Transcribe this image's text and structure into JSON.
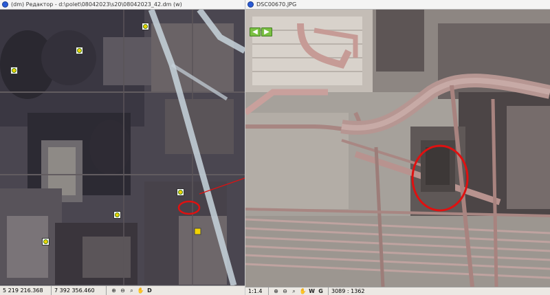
{
  "map_window": {
    "title": "(dm) Редактор - d:\\polet\\08042023\\s20\\08042023_42.dm (w)",
    "status": {
      "coord_x": "5 219 216.368",
      "coord_y": "7 392 356.460",
      "tools": [
        {
          "icon": "zoom-in-icon",
          "glyph": "⊕"
        },
        {
          "icon": "zoom-out-icon",
          "glyph": "⊖"
        },
        {
          "icon": "zoom-fit-icon",
          "glyph": "⌕"
        },
        {
          "icon": "pan-hand-icon",
          "glyph": "✋"
        },
        {
          "icon": "d-tool-icon",
          "glyph": "D"
        }
      ]
    }
  },
  "photo_window": {
    "title": "DSC00670.JPG",
    "nav": {
      "prev": "◀",
      "next": "▶"
    },
    "status": {
      "scale": "1:1.4",
      "pixel_coords": "3089 : 1362",
      "tools": [
        {
          "icon": "zoom-in-icon",
          "glyph": "⊕"
        },
        {
          "icon": "zoom-out-icon",
          "glyph": "⊖"
        },
        {
          "icon": "zoom-fit-icon",
          "glyph": "⌕"
        },
        {
          "icon": "pan-hand-icon",
          "glyph": "✋"
        },
        {
          "icon": "w-tool-icon",
          "glyph": "W"
        },
        {
          "icon": "g-tool-icon",
          "glyph": "G"
        }
      ]
    }
  },
  "colors": {
    "annotation_red": "#e01010",
    "map_track": "#c7d3dc",
    "marker_fill": "#f2d300",
    "nav_green": "#7bc043"
  }
}
